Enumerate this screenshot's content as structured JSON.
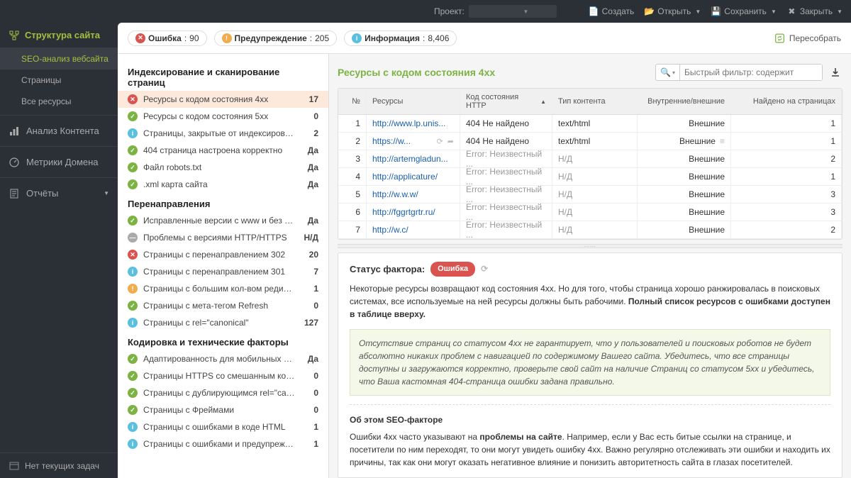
{
  "topbar": {
    "project_label": "Проект:",
    "create": "Создать",
    "open": "Открыть",
    "save": "Сохранить",
    "close": "Закрыть"
  },
  "sidebar": {
    "structure": "Структура сайта",
    "items": [
      "SEO-анализ вебсайта",
      "Страницы",
      "Все ресурсы"
    ],
    "analysis": "Анализ Контента",
    "metrics": "Метрики Домена",
    "reports": "Отчёты",
    "footer": "Нет текущих задач"
  },
  "stats": {
    "error_label": "Ошибка",
    "error_count": "90",
    "warn_label": "Предупреждение",
    "warn_count": "205",
    "info_label": "Информация",
    "info_count": "8,406",
    "rebuild": "Пересобрать"
  },
  "sections": [
    {
      "title": "Индексирование и сканирование страниц",
      "rows": [
        {
          "status": "err",
          "label": "Ресурсы с кодом состояния 4xx",
          "val": "17",
          "sel": true
        },
        {
          "status": "ok",
          "label": "Ресурсы с кодом состояния 5xx",
          "val": "0"
        },
        {
          "status": "info",
          "label": "Страницы, закрытые от индексирования",
          "val": "2"
        },
        {
          "status": "ok",
          "label": "404 страница настроена корректно",
          "val": "Да"
        },
        {
          "status": "ok",
          "label": "Файл robots.txt",
          "val": "Да"
        },
        {
          "status": "ok",
          "label": ".xml карта сайта",
          "val": "Да"
        }
      ]
    },
    {
      "title": "Перенаправления",
      "rows": [
        {
          "status": "ok",
          "label": "Исправленные версии с www и без www",
          "val": "Да"
        },
        {
          "status": "gray",
          "label": "Проблемы с версиями HTTP/HTTPS",
          "val": "Н/Д"
        },
        {
          "status": "err",
          "label": "Страницы с перенаправлением 302",
          "val": "20"
        },
        {
          "status": "info",
          "label": "Страницы с перенаправлением 301",
          "val": "7"
        },
        {
          "status": "warn",
          "label": "Страницы с большим кол-вом редиректов",
          "val": "1"
        },
        {
          "status": "ok",
          "label": "Страницы с мета-тегом Refresh",
          "val": "0"
        },
        {
          "status": "info",
          "label": "Страницы с rel=\"canonical\"",
          "val": "127"
        }
      ]
    },
    {
      "title": "Кодировка и технические факторы",
      "rows": [
        {
          "status": "ok",
          "label": "Адаптированность для мобильных устрой...",
          "val": "Да"
        },
        {
          "status": "ok",
          "label": "Страницы HTTPS со смешанным контентом",
          "val": "0"
        },
        {
          "status": "ok",
          "label": "Страницы с дублирующимся rel=\"canonical\"",
          "val": "0"
        },
        {
          "status": "ok",
          "label": "Страницы с Фреймами",
          "val": "0"
        },
        {
          "status": "info",
          "label": "Страницы с ошибками в коде HTML",
          "val": "1"
        },
        {
          "status": "info",
          "label": "Страницы с ошибками и предупреждени...",
          "val": "1"
        }
      ]
    }
  ],
  "right": {
    "title": "Ресурсы с кодом состояния 4xx",
    "filter_placeholder": "Быстрый фильтр: содержит",
    "columns": [
      "№",
      "Ресурсы",
      "Код состояния HTTP",
      "Тип контента",
      "Внутренние/внешние",
      "Найдено на страницах"
    ],
    "rows": [
      {
        "n": "1",
        "url": "http://www.lp.unis...",
        "code": "404 Не найдено",
        "ct": "text/html",
        "ie": "Внешние",
        "f": "1"
      },
      {
        "n": "2",
        "url": "https://w...",
        "code": "404 Не найдено",
        "ct": "text/html",
        "ie": "Внешние",
        "f": "1",
        "icons": true
      },
      {
        "n": "3",
        "url": "http://artemgladun...",
        "code": "Error: Неизвестный ...",
        "ct": "Н/Д",
        "ie": "Внешние",
        "f": "2",
        "gray": true
      },
      {
        "n": "4",
        "url": "http://applicature/",
        "code": "Error: Неизвестный ...",
        "ct": "Н/Д",
        "ie": "Внешние",
        "f": "1",
        "gray": true
      },
      {
        "n": "5",
        "url": "http://w.w.w/",
        "code": "Error: Неизвестный ...",
        "ct": "Н/Д",
        "ie": "Внешние",
        "f": "3",
        "gray": true
      },
      {
        "n": "6",
        "url": "http://fggrtgrtr.ru/",
        "code": "Error: Неизвестный ...",
        "ct": "Н/Д",
        "ie": "Внешние",
        "f": "3",
        "gray": true
      },
      {
        "n": "7",
        "url": "http://w.c/",
        "code": "Error: Неизвестный ...",
        "ct": "Н/Д",
        "ie": "Внешние",
        "f": "2",
        "gray": true
      }
    ]
  },
  "detail": {
    "status_label": "Статус фактора:",
    "status_badge": "Ошибка",
    "p1a": "Некоторые ресурсы возвращают код состояния 4xx. Но для того, чтобы страница хорошо ранжировалась в поисковых системах, все используемые на ней ресурсы должны быть рабочими. ",
    "p1b": "Полный список ресурсов с ошибками доступен в таблице вверху.",
    "note_a": "Отсутствие страниц со статусом 4xx не гарантирует, что у пользователей и поисковых роботов не будет абсолютно никаких проблем с навигацией по содержимому Вашего сайта. Убедитесь, что все страницы доступны и загружаются корректно, проверьте свой сайт на наличие ",
    "note_i1": "Страниц со статусом 5xx",
    "note_b": " и убедитесь, что Ваша ",
    "note_i2": "кастомная 404-страница ошибки",
    "note_c": " задана правильно.",
    "about_title": "Об этом SEO-факторе",
    "p2a": "Ошибки 4xx часто указывают на ",
    "p2b": "проблемы на сайте",
    "p2c": ". Например, если у Вас есть битые ссылки на странице, и посетители по ним переходят, то они могут увидеть ошибку 4xx. Важно регулярно отслеживать эти ошибки и находить их причины, так как они могут оказать негативное влияние и понизить авторитетность сайта в глазах посетителей."
  }
}
